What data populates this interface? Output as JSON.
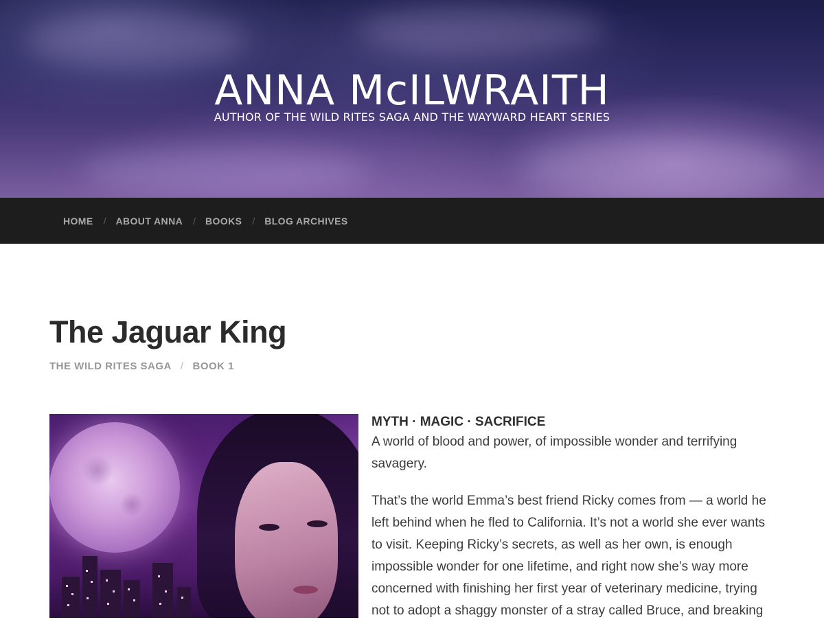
{
  "site": {
    "title": "ANNA McILWRAITH",
    "tagline": "AUTHOR OF THE WILD RITES SAGA AND THE WAYWARD HEART SERIES"
  },
  "nav": {
    "items": [
      {
        "label": "HOME"
      },
      {
        "label": "ABOUT ANNA"
      },
      {
        "label": "BOOKS"
      },
      {
        "label": "BLOG ARCHIVES"
      }
    ],
    "separator": "/"
  },
  "page": {
    "title": "The Jaguar King",
    "breadcrumb": [
      "THE WILD RITES SAGA",
      "BOOK 1"
    ]
  },
  "blurb": {
    "heading": "MYTH · MAGIC · SACRIFICE",
    "paragraphs": [
      "A world of blood and power, of impossible wonder and terrifying savagery.",
      "That’s the world Emma’s best friend Ricky comes from — a world he left behind when he fled to California. It’s not a world she ever wants to visit. Keeping Ricky’s secrets, as well as her own, is enough impossible wonder for one lifetime, and right now she’s way more concerned with finishing her first year of veterinary medicine, trying not to adopt a shaggy monster of a stray called Bruce, and breaking"
    ]
  },
  "colors": {
    "navbar_bg": "#1d1d1d",
    "nav_text": "#a9a9a9",
    "title_text": "#2b2b2b",
    "meta_text": "#979797"
  }
}
